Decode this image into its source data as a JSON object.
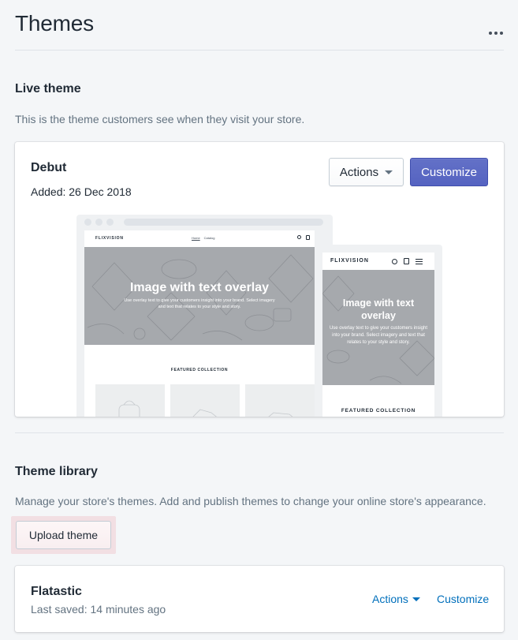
{
  "page": {
    "title": "Themes"
  },
  "live_theme": {
    "heading": "Live theme",
    "description": "This is the theme customers see when they visit your store.",
    "card": {
      "name": "Debut",
      "added": "Added: 26 Dec 2018",
      "actions_label": "Actions",
      "customize_label": "Customize"
    },
    "preview": {
      "brand": "FLIXVISION",
      "nav_links": [
        "Home",
        "Catalog"
      ],
      "hero_title": "Image with text overlay",
      "hero_subtitle": "Use overlay text to give your customers insight into your brand. Select imagery and text that relates to your style and story.",
      "featured_label": "FEATURED COLLECTION"
    }
  },
  "theme_library": {
    "heading": "Theme library",
    "description": "Manage your store's themes. Add and publish themes to change your online store's appearance.",
    "upload_label": "Upload theme",
    "themes": [
      {
        "name": "Flatastic",
        "last_saved": "Last saved: 14 minutes ago",
        "actions_label": "Actions",
        "customize_label": "Customize"
      }
    ]
  },
  "colors": {
    "primary": "#5c6ac4",
    "link": "#006fbb",
    "background": "#f4f6f8",
    "highlight": "#f2dfe3"
  }
}
